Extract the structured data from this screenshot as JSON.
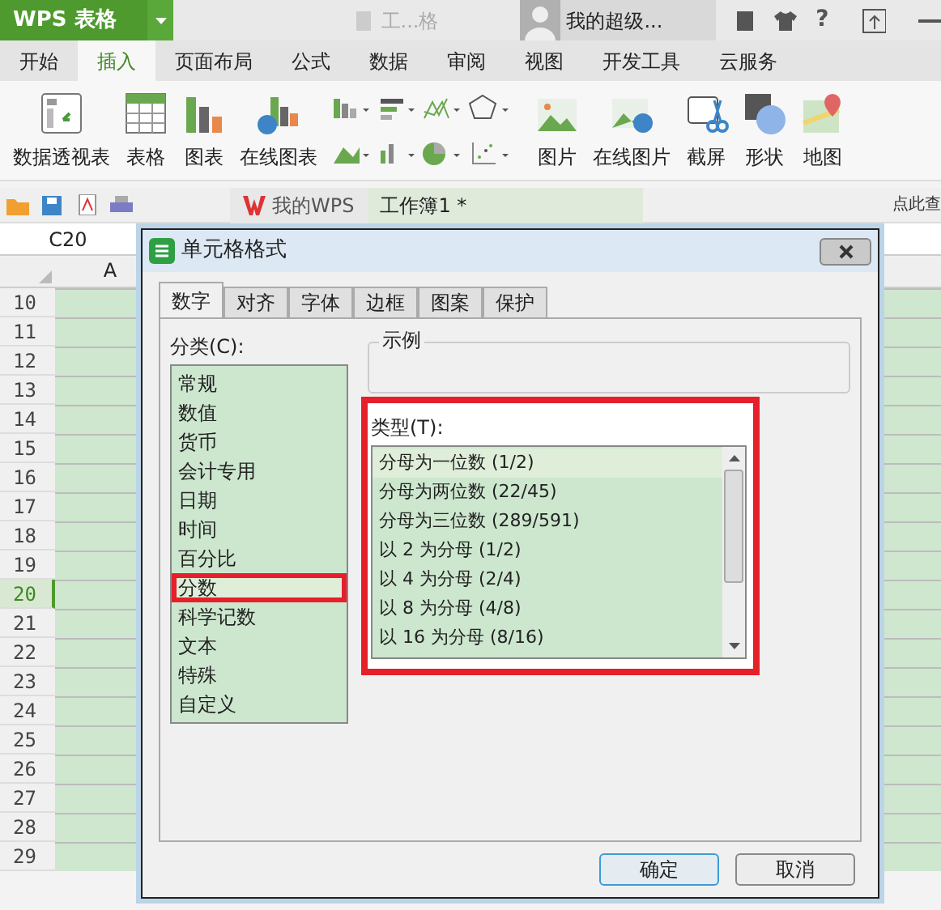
{
  "app_button": "WPS 表格",
  "doc_title": "工...格",
  "user_name": "我的超级...",
  "help": "?",
  "ribbon_tabs": [
    {
      "label": "开始",
      "selected": false
    },
    {
      "label": "插入",
      "selected": true
    },
    {
      "label": "页面布局",
      "selected": false
    },
    {
      "label": "公式",
      "selected": false
    },
    {
      "label": "数据",
      "selected": false
    },
    {
      "label": "审阅",
      "selected": false
    },
    {
      "label": "视图",
      "selected": false
    },
    {
      "label": "开发工具",
      "selected": false
    },
    {
      "label": "云服务",
      "selected": false
    }
  ],
  "ribbon_tools": [
    {
      "kind": "pivot",
      "label": "数据透视表"
    },
    {
      "kind": "table",
      "label": "表格"
    },
    {
      "kind": "chart",
      "label": "图表"
    },
    {
      "kind": "online-chart",
      "label": "在线图表"
    },
    {
      "kind": "chart-grid"
    },
    {
      "kind": "picture",
      "label": "图片"
    },
    {
      "kind": "online-picture",
      "label": "在线图片"
    },
    {
      "kind": "screenshot",
      "label": "截屏"
    },
    {
      "kind": "shape",
      "label": "形状"
    },
    {
      "kind": "map",
      "label": "地图"
    }
  ],
  "doc_tabs": [
    {
      "label": "我的WPS",
      "selected": false
    },
    {
      "label": "工作簿1 *",
      "selected": true
    }
  ],
  "search_hint": "点此查",
  "name_box": "C20",
  "column_header": "A",
  "rows": [
    {
      "label": "10",
      "selected": false
    },
    {
      "label": "11",
      "selected": false
    },
    {
      "label": "12",
      "selected": false
    },
    {
      "label": "13",
      "selected": false
    },
    {
      "label": "14",
      "selected": false
    },
    {
      "label": "15",
      "selected": false
    },
    {
      "label": "16",
      "selected": false
    },
    {
      "label": "17",
      "selected": false
    },
    {
      "label": "18",
      "selected": false
    },
    {
      "label": "19",
      "selected": false
    },
    {
      "label": "20",
      "selected": true
    },
    {
      "label": "21",
      "selected": false
    },
    {
      "label": "22",
      "selected": false
    },
    {
      "label": "23",
      "selected": false
    },
    {
      "label": "24",
      "selected": false
    },
    {
      "label": "25",
      "selected": false
    },
    {
      "label": "26",
      "selected": false
    },
    {
      "label": "27",
      "selected": false
    },
    {
      "label": "28",
      "selected": false
    },
    {
      "label": "29",
      "selected": false
    }
  ],
  "dialog": {
    "title": "单元格格式",
    "tabs": [
      {
        "label": "数字",
        "selected": true
      },
      {
        "label": "对齐",
        "selected": false
      },
      {
        "label": "字体",
        "selected": false
      },
      {
        "label": "边框",
        "selected": false
      },
      {
        "label": "图案",
        "selected": false
      },
      {
        "label": "保护",
        "selected": false
      }
    ],
    "category_label": "分类(C):",
    "categories": [
      {
        "label": "常规",
        "selected": false
      },
      {
        "label": "数值",
        "selected": false
      },
      {
        "label": "货币",
        "selected": false
      },
      {
        "label": "会计专用",
        "selected": false
      },
      {
        "label": "日期",
        "selected": false
      },
      {
        "label": "时间",
        "selected": false
      },
      {
        "label": "百分比",
        "selected": false
      },
      {
        "label": "分数",
        "selected": true
      },
      {
        "label": "科学记数",
        "selected": false
      },
      {
        "label": "文本",
        "selected": false
      },
      {
        "label": "特殊",
        "selected": false
      },
      {
        "label": "自定义",
        "selected": false
      }
    ],
    "sample_label": "示例",
    "type_label": "类型(T):",
    "types": [
      {
        "label": "分母为一位数 (1/2)",
        "selected": true
      },
      {
        "label": "分母为两位数 (22/45)",
        "selected": false
      },
      {
        "label": "分母为三位数 (289/591)",
        "selected": false
      },
      {
        "label": "以 2 为分母 (1/2)",
        "selected": false
      },
      {
        "label": "以 4 为分母 (2/4)",
        "selected": false
      },
      {
        "label": "以 8 为分母 (4/8)",
        "selected": false
      },
      {
        "label": "以 16 为分母 (8/16)",
        "selected": false
      }
    ],
    "buttons": [
      {
        "label": "确定",
        "kind": "default"
      },
      {
        "label": "取消",
        "kind": "normal"
      }
    ]
  }
}
